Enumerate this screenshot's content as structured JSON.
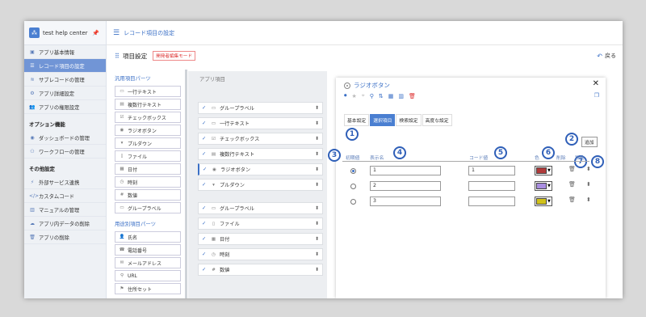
{
  "sidebar": {
    "app_name": "test help center",
    "items": [
      {
        "label": "アプリ基本情報",
        "icon": "info-icon",
        "glyph": "▣"
      },
      {
        "label": "レコード項目の設定",
        "icon": "list-icon",
        "glyph": "☰",
        "active": true
      },
      {
        "label": "サブレコードの管理",
        "icon": "layers-icon",
        "glyph": "≋"
      },
      {
        "label": "アプリ詳細設定",
        "icon": "settings-icon",
        "glyph": "⚙"
      },
      {
        "label": "アプリの権限設定",
        "icon": "users-icon",
        "glyph": "👥"
      }
    ],
    "section_options": "オプション機能",
    "option_items": [
      {
        "label": "ダッシュボードの管理",
        "icon": "dashboard-icon",
        "glyph": "◉"
      },
      {
        "label": "ワークフローの管理",
        "icon": "workflow-icon",
        "glyph": "⚇"
      }
    ],
    "section_other": "その他設定",
    "other_items": [
      {
        "label": "外部サービス連携",
        "icon": "plug-icon",
        "glyph": "⚡"
      },
      {
        "label": "カスタムコード",
        "icon": "code-icon",
        "glyph": "</>"
      },
      {
        "label": "マニュアルの管理",
        "icon": "book-icon",
        "glyph": "▥"
      },
      {
        "label": "アプリ内データの削除",
        "icon": "cloud-delete-icon",
        "glyph": "☁"
      },
      {
        "label": "アプリの削除",
        "icon": "trash-icon",
        "glyph": "🗑"
      }
    ]
  },
  "topbar": {
    "title": "レコード項目の設定"
  },
  "subbar": {
    "title": "項目設定",
    "badge": "開発者編集モード",
    "back": "戻る"
  },
  "parts": {
    "general_title": "汎用項目パーツ",
    "general": [
      {
        "label": "一行テキスト",
        "glyph": "▭"
      },
      {
        "label": "複数行テキスト",
        "glyph": "▤"
      },
      {
        "label": "チェックボックス",
        "glyph": "☑"
      },
      {
        "label": "ラジオボタン",
        "glyph": "◉"
      },
      {
        "label": "プルダウン",
        "glyph": "▾"
      },
      {
        "label": "ファイル",
        "glyph": "▯"
      },
      {
        "label": "日付",
        "glyph": "▦"
      },
      {
        "label": "時刻",
        "glyph": "◷"
      },
      {
        "label": "数値",
        "glyph": "#"
      },
      {
        "label": "グループラベル",
        "glyph": "▭"
      }
    ],
    "special_title": "用途別項目パーツ",
    "special": [
      {
        "label": "氏名",
        "glyph": "👤"
      },
      {
        "label": "電話番号",
        "glyph": "☎"
      },
      {
        "label": "メールアドレス",
        "glyph": "✉"
      },
      {
        "label": "URL",
        "glyph": "⚲"
      },
      {
        "label": "住所セット",
        "glyph": "⚑"
      }
    ]
  },
  "field_area": {
    "title": "アプリ項目",
    "group1": [
      {
        "label": "グループラベル",
        "glyph": "▭"
      },
      {
        "label": "一行テキスト",
        "glyph": "▭"
      },
      {
        "label": "チェックボックス",
        "glyph": "☑"
      },
      {
        "label": "複数行テキスト",
        "glyph": "▤"
      },
      {
        "label": "ラジオボタン",
        "glyph": "◉",
        "selected": true
      },
      {
        "label": "プルダウン",
        "glyph": "▾"
      }
    ],
    "group2": [
      {
        "label": "グループラベル",
        "glyph": "▭"
      },
      {
        "label": "ファイル",
        "glyph": "▯"
      },
      {
        "label": "日付",
        "glyph": "▦"
      },
      {
        "label": "時刻",
        "glyph": "◷"
      },
      {
        "label": "数値",
        "glyph": "#"
      }
    ]
  },
  "panel": {
    "title": "ラジオボタン",
    "tabs": [
      {
        "label": "基本設定"
      },
      {
        "label": "選択項目",
        "active": true
      },
      {
        "label": "検索設定"
      },
      {
        "label": "高度な設定"
      }
    ],
    "add_label": "追加",
    "headers": {
      "default": "初期値",
      "display_name": "表示名",
      "code": "コード値",
      "color": "色",
      "delete": "削除",
      "move": "移動"
    },
    "options": [
      {
        "name": "1",
        "code": "1",
        "color": "#b03a3a",
        "default": true
      },
      {
        "name": "2",
        "code": "",
        "color": "#a98ee0",
        "default": false
      },
      {
        "name": "3",
        "code": "",
        "color": "#d1c21a",
        "default": false
      }
    ]
  },
  "annotations": [
    "1",
    "2",
    "3",
    "4",
    "5",
    "6",
    "7",
    "8"
  ]
}
